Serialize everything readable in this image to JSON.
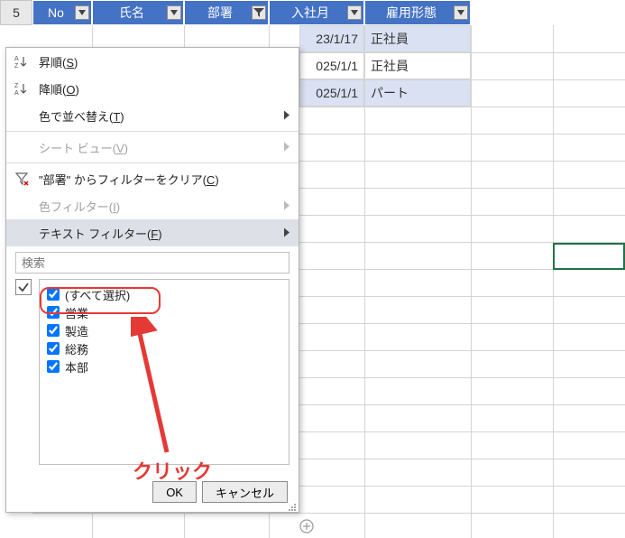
{
  "header": {
    "row_number": "5",
    "columns": [
      {
        "label": "No",
        "filter_active": false
      },
      {
        "label": "氏名",
        "filter_active": false
      },
      {
        "label": "部署",
        "filter_active": true
      },
      {
        "label": "入社月",
        "filter_active": false
      },
      {
        "label": "雇用形態",
        "filter_active": false
      }
    ]
  },
  "data_rows": [
    {
      "d": "23/1/17",
      "e": "正社員",
      "alt": true
    },
    {
      "d": "025/1/1",
      "e": "正社員",
      "alt": false
    },
    {
      "d": "025/1/1",
      "e": "パート",
      "alt": true
    }
  ],
  "menu": {
    "sort_asc": {
      "label": "昇順(",
      "key": "S",
      "tail": ")"
    },
    "sort_desc": {
      "label": "降順(",
      "key": "O",
      "tail": ")"
    },
    "sort_color": {
      "label": "色で並べ替え(",
      "key": "T",
      "tail": ")"
    },
    "sheet_view": {
      "label": "シート ビュー(",
      "key": "V",
      "tail": ")"
    },
    "clear_filter": {
      "label": "\"部署\" からフィルターをクリア(",
      "key": "C",
      "tail": ")"
    },
    "color_filter": {
      "label": "色フィルター(",
      "key": "I",
      "tail": ")"
    },
    "text_filter": {
      "label": "テキスト フィルター(",
      "key": "F",
      "tail": ")"
    }
  },
  "search": {
    "placeholder": "検索"
  },
  "checklist": [
    {
      "label": "(すべて選択)",
      "checked": true
    },
    {
      "label": "営業",
      "checked": true
    },
    {
      "label": "製造",
      "checked": true
    },
    {
      "label": "総務",
      "checked": true
    },
    {
      "label": "本部",
      "checked": true
    }
  ],
  "annotation_text": "クリック",
  "buttons": {
    "ok": "OK",
    "cancel": "キャンセル"
  }
}
